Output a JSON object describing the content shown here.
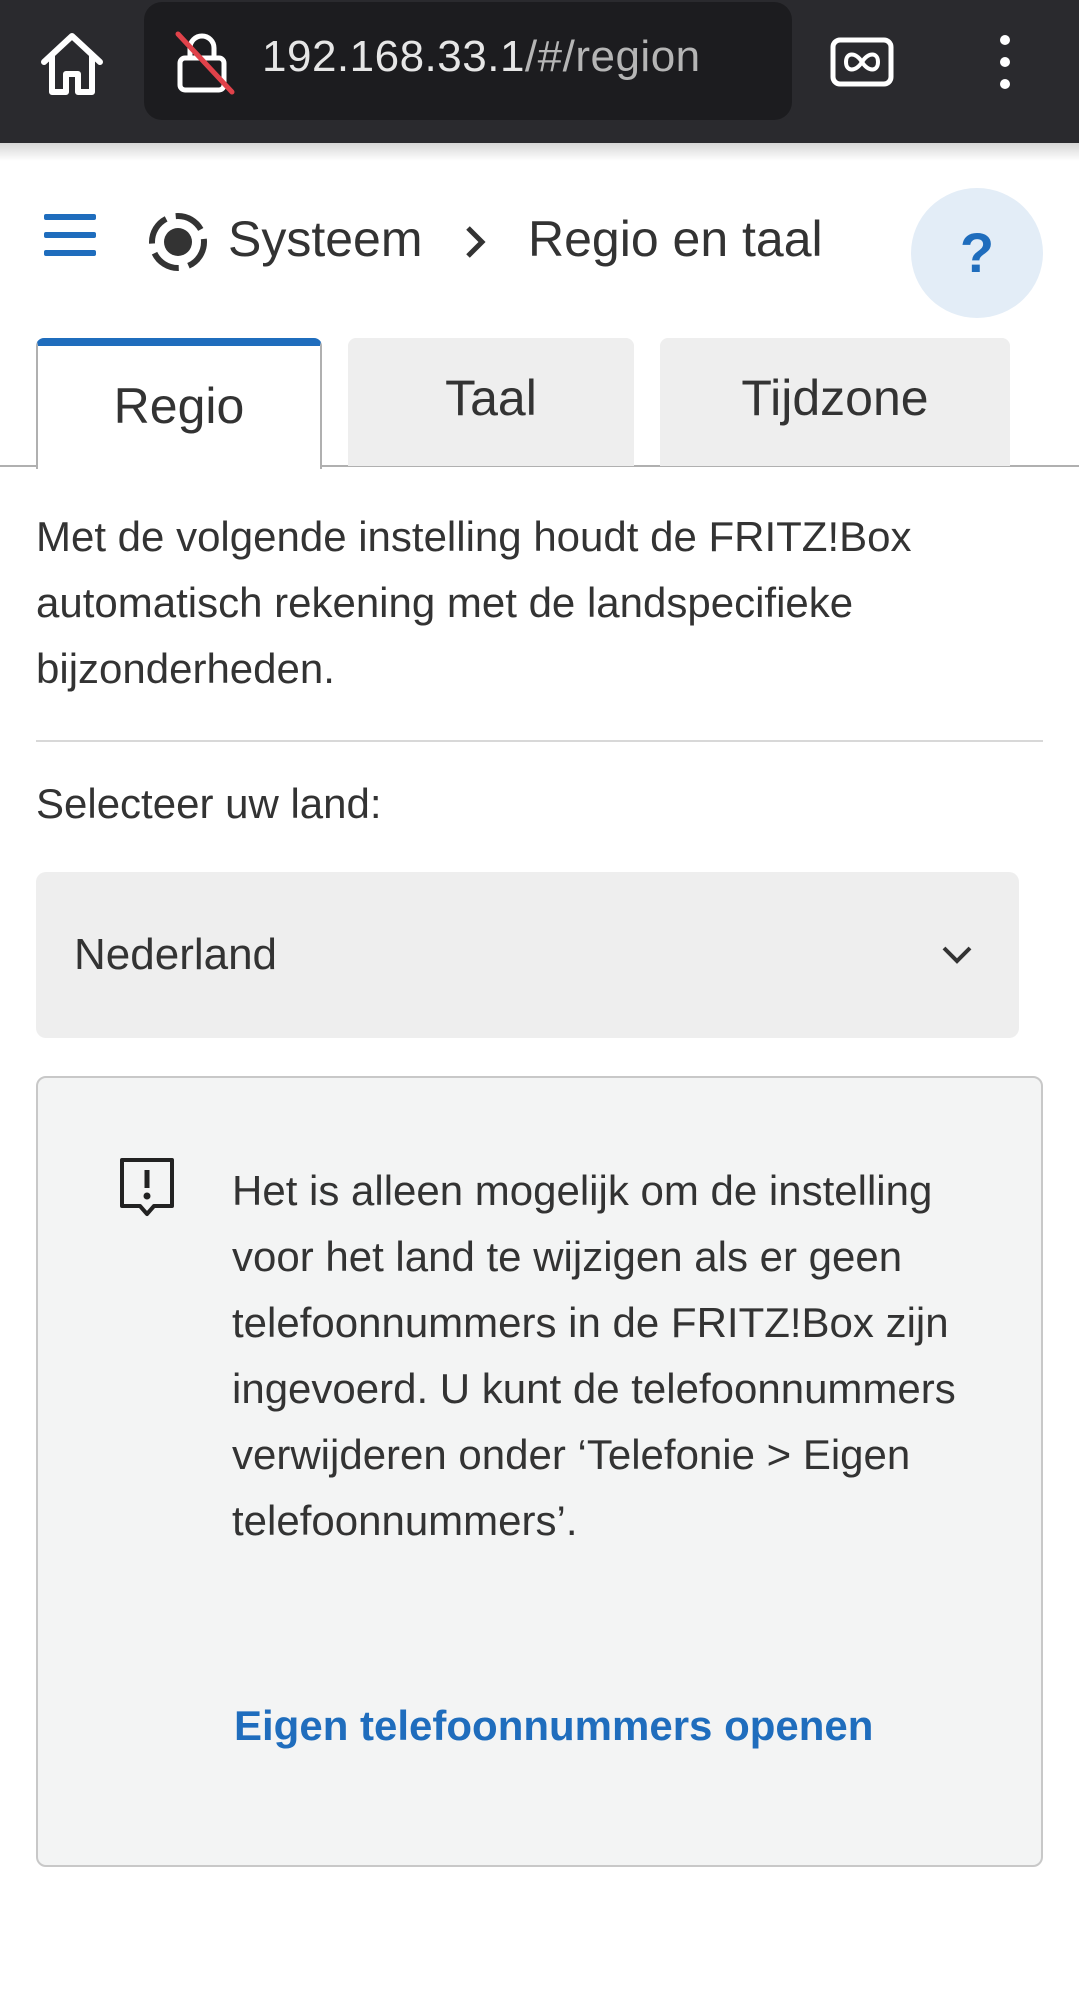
{
  "browser": {
    "url_host": "192.168.33.1",
    "url_path": "/#/region",
    "icons": [
      "home-icon",
      "insecure-lock-icon",
      "tabs-icon",
      "more-vert-icon"
    ]
  },
  "header": {
    "breadcrumb_parent": "Systeem",
    "breadcrumb_current": "Regio en taal",
    "help_label": "?"
  },
  "tabs": [
    {
      "label": "Regio",
      "active": true
    },
    {
      "label": "Taal",
      "active": false
    },
    {
      "label": "Tijdzone",
      "active": false
    }
  ],
  "main": {
    "intro": "Met de volgende instelling houdt de FRITZ!Box automatisch rekening met de landspecifieke bijzonderheden.",
    "select_label": "Selecteer uw land:",
    "select_value": "Nederland",
    "info_text": "Het is alleen mogelijk om de instelling voor het land te wijzigen als er geen telefoonnummers in de FRITZ!Box zijn ingevoerd. U kunt de telefoonnummers verwijderen onder ‘Telefonie > Eigen telefoonnummers’.",
    "info_link": "Eigen telefoonnummers openen"
  },
  "colors": {
    "accent": "#1f6dbd",
    "browser_bar": "#2a2a2e",
    "panel": "#f3f4f4"
  }
}
